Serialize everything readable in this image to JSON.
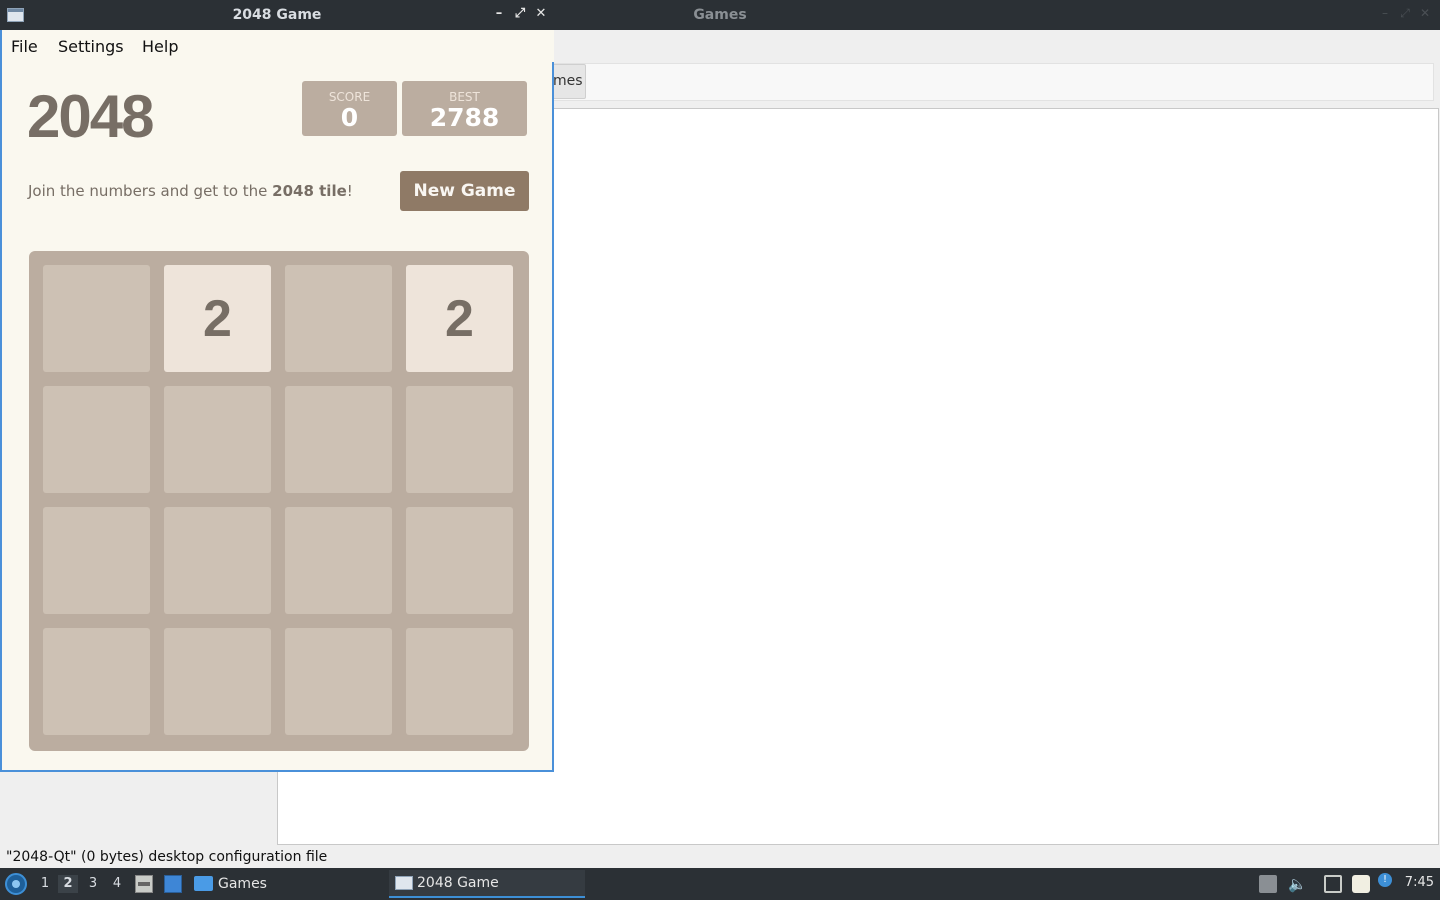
{
  "background_window": {
    "title": "Games",
    "tab_label": "mes",
    "status_text": "\"2048-Qt\" (0 bytes) desktop configuration file"
  },
  "game_window": {
    "title": "2048 Game",
    "controls": {
      "minimize": "–",
      "maximize": "⤢",
      "close": "✕"
    },
    "menu": [
      "File",
      "Settings",
      "Help"
    ],
    "logo": "2048",
    "score": {
      "label": "SCORE",
      "value": "0"
    },
    "best": {
      "label": "BEST",
      "value": "2788"
    },
    "tagline": {
      "prefix": "Join the numbers and get to the ",
      "bold": "2048 tile",
      "suffix": "!"
    },
    "new_game_label": "New Game",
    "board": [
      [
        "",
        "2",
        "",
        "2"
      ],
      [
        "",
        "",
        "",
        ""
      ],
      [
        "",
        "",
        "",
        ""
      ],
      [
        "",
        "",
        "",
        ""
      ]
    ],
    "colors": {
      "empty_tile": "#cdc1b4",
      "tile_2": "#eee4da",
      "board": "#bbada0",
      "button": "#8f7a66"
    }
  },
  "taskbar": {
    "workspaces": [
      "1",
      "2",
      "3",
      "4"
    ],
    "active_workspace": "2",
    "tasks": [
      "Games",
      "2048 Game"
    ],
    "clock": "7:45"
  }
}
